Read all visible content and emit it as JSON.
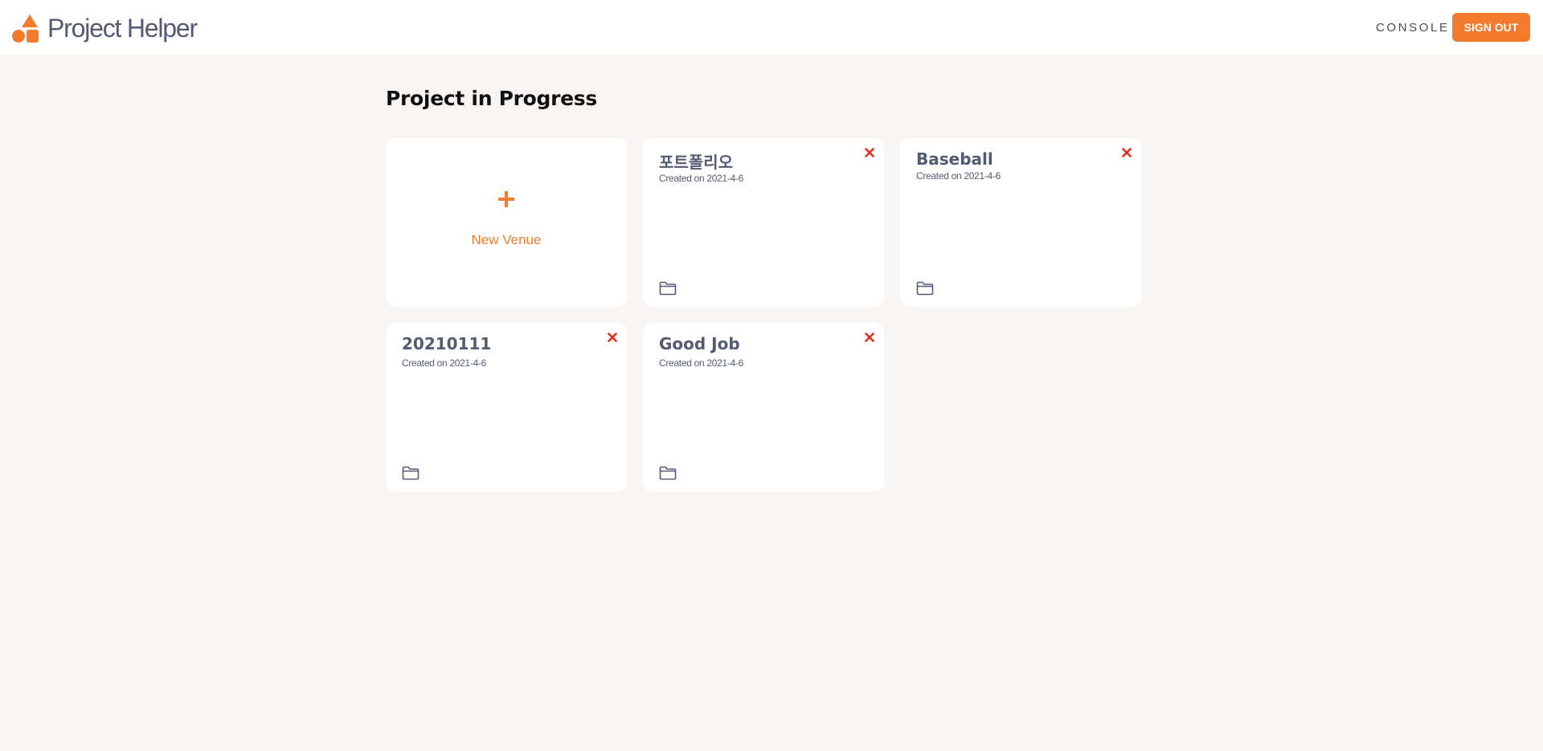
{
  "header": {
    "logo_text": "Project Helper",
    "console_label": "CONSOLE",
    "signout_label": "SIGN OUT"
  },
  "main": {
    "title": "Project in Progress",
    "new_card": {
      "label": "New Venue",
      "icon": "plus-icon"
    },
    "projects": [
      {
        "title": "포트폴리오",
        "date": "Created on 2021-4-6"
      },
      {
        "title": "Baseball",
        "date": "Created on 2021-4-6"
      },
      {
        "title": "20210111",
        "date": "Created on 2021-4-6"
      },
      {
        "title": "Good Job",
        "date": "Created on 2021-4-6"
      }
    ]
  },
  "colors": {
    "accent": "#f47b2d",
    "background": "#f8f5f2",
    "text": "#545a72",
    "close": "#e0301e"
  }
}
